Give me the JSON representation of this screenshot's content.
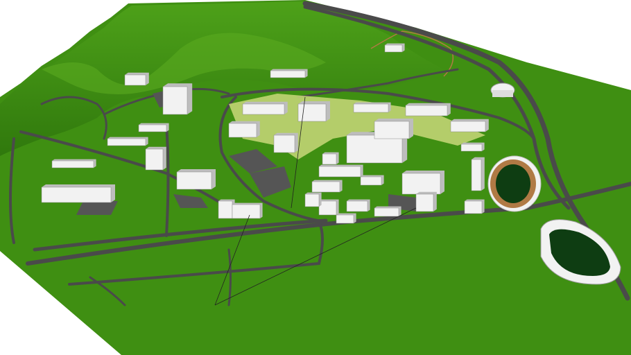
{
  "scene": {
    "type": "3d-campus-model",
    "colors": {
      "background": "#ffffff",
      "terrain": "#3f8f12",
      "terrain_dark": "#2f7a0c",
      "terrain_light": "#5aa81e",
      "road": "#4a4a4a",
      "path": "#e8e2a0",
      "building": "#f2f2f2",
      "building_shadow": "#bdbdbd",
      "track": "#b07a45",
      "field": "#0e3d12",
      "plaza": "#c9d87a"
    }
  }
}
